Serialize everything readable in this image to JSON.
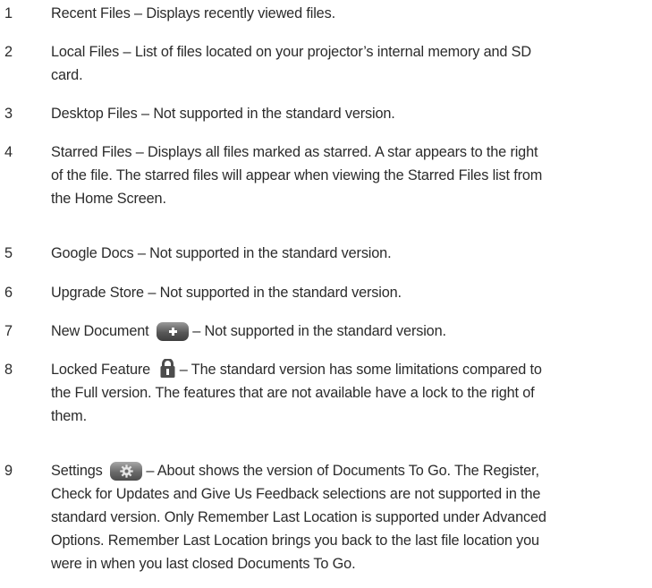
{
  "items": [
    {
      "number": "1",
      "lines": [
        "Recent Files – Displays recently viewed files."
      ]
    },
    {
      "number": "2",
      "lines": [
        "Local Files – List of files located on your projector’s internal memory and SD",
        "card."
      ]
    },
    {
      "number": "3",
      "lines": [
        "Desktop Files – Not supported in the standard version."
      ]
    },
    {
      "number": "4",
      "lines": [
        "Starred Files – Displays all files marked as starred. A star appears to the right",
        "of the file. The starred files will appear when viewing the Starred Files list from",
        "the Home Screen."
      ]
    },
    {
      "number": "5",
      "lines": [
        "Google Docs – Not supported in the standard version."
      ]
    },
    {
      "number": "6",
      "lines": [
        "Upgrade Store – Not supported in the standard version."
      ]
    },
    {
      "number": "7",
      "pre": "New Document",
      "post": "– Not supported in the standard version.",
      "icon": "plus-button-icon"
    },
    {
      "number": "8",
      "pre": "Locked Feature",
      "post": "– The standard version has some limitations compared to",
      "lines": [
        "the Full version. The features that are not available have a lock to the right of",
        "them."
      ],
      "icon": "lock-icon"
    },
    {
      "number": "9",
      "pre": "Settings",
      "post": "– About shows the version of Documents To Go. The Register,",
      "lines": [
        "Check for Updates and Give Us Feedback selections are not supported in the",
        "standard version. Only Remember Last Location is supported under Advanced",
        "Options. Remember Last Location brings you back to the last file location you",
        "were in when you last closed Documents To Go."
      ],
      "icon": "settings-gear-icon"
    }
  ]
}
